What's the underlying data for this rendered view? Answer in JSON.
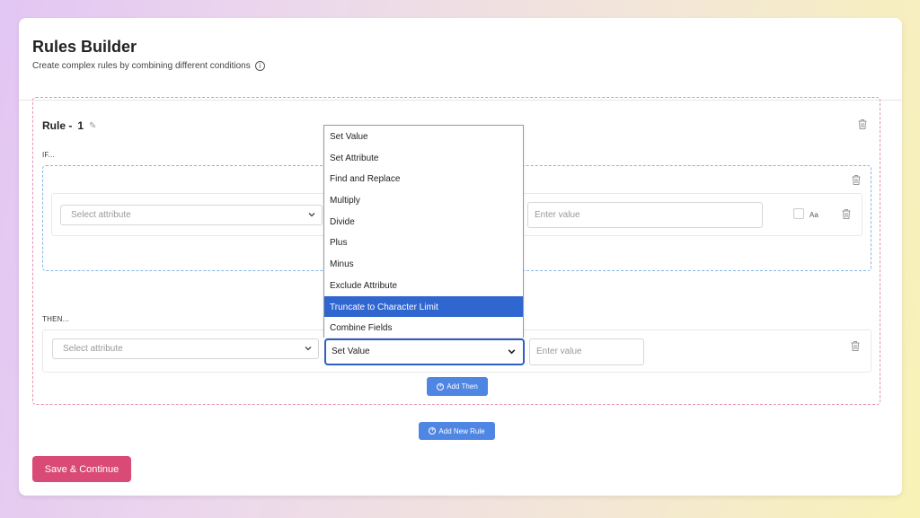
{
  "header": {
    "title": "Rules Builder",
    "subtitle": "Create complex rules by combining different conditions",
    "info_icon": "i"
  },
  "rule": {
    "label": "Rule -",
    "number": "1",
    "pencil_icon": "✎",
    "if_label": "IF...",
    "then_label": "THEN...",
    "condition": {
      "attribute_placeholder": "Select attribute",
      "value_placeholder": "Enter value",
      "case_label": "Aa"
    },
    "action": {
      "attribute_placeholder": "Select attribute",
      "action_selected": "Set Value",
      "value_placeholder": "Enter value"
    },
    "add_then_label": "Add Then"
  },
  "add_rule_label": "Add New Rule",
  "save_label": "Save & Continue",
  "dropdown": {
    "options": [
      "Set Value",
      "Set Attribute",
      "Find and Replace",
      "Multiply",
      "Divide",
      "Plus",
      "Minus",
      "Exclude Attribute",
      "Truncate to Character Limit",
      "Combine Fields"
    ],
    "highlighted": "Truncate to Character Limit"
  },
  "colors": {
    "primary_blue": "#4f86e3",
    "save_pink": "#d94a77",
    "rule_border": "#e890b8",
    "if_border": "#86b5e6",
    "highlight": "#2f66cf"
  }
}
